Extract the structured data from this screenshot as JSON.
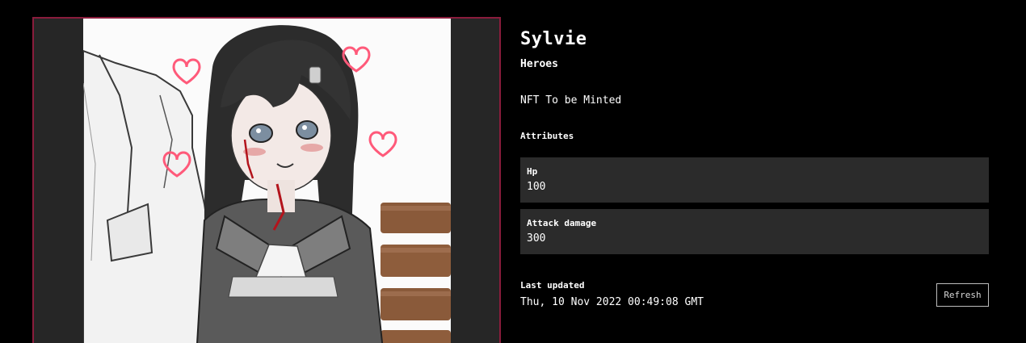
{
  "nft": {
    "name": "Sylvie",
    "collection": "Heroes",
    "status": "NFT To be Minted"
  },
  "attributes": {
    "heading": "Attributes",
    "items": [
      {
        "name": "Hp",
        "value": "100"
      },
      {
        "name": "Attack damage",
        "value": "300"
      }
    ]
  },
  "updated": {
    "label": "Last updated",
    "value": "Thu, 10 Nov 2022 00:49:08 GMT"
  },
  "actions": {
    "refresh_label": "Refresh"
  },
  "colors": {
    "background": "#000000",
    "card": "#2b2b2b",
    "image_border": "#8a1c3c",
    "image_letterbox": "#262626"
  },
  "artwork": {
    "alt_subject": "anime-girl-artwork"
  }
}
